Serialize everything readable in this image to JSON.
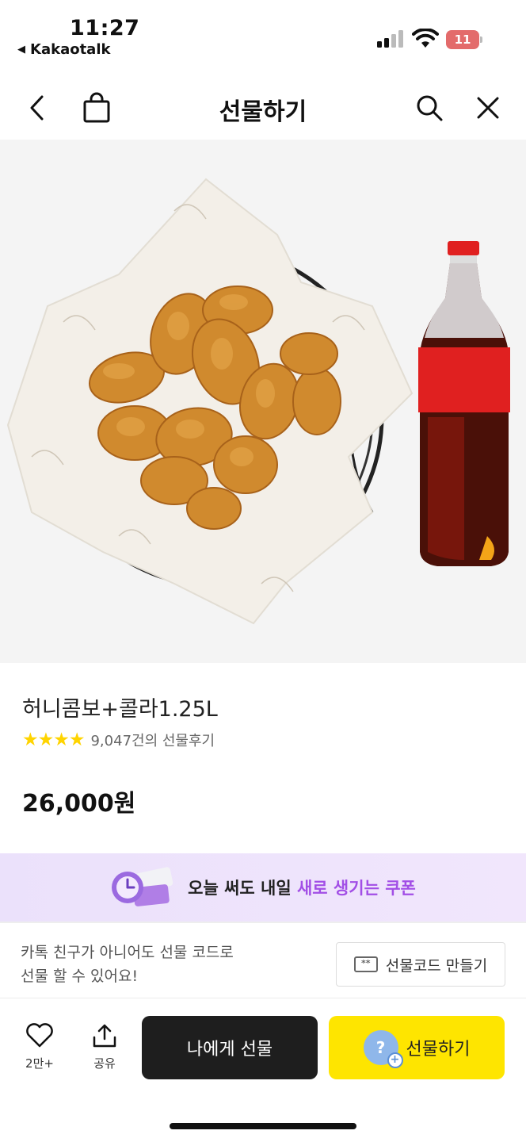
{
  "status_bar": {
    "time": "11:27",
    "back_app": "Kakaotalk",
    "battery": "11"
  },
  "header": {
    "title": "선물하기",
    "icons": [
      "back-arrow-icon",
      "shopping-bag-icon",
      "search-icon",
      "close-icon"
    ]
  },
  "product": {
    "name": "허니콤보+콜라1.25L",
    "stars": "★★★★",
    "rating_value": 4,
    "review_count": "9,047건의 선물후기",
    "price": "26,000원"
  },
  "coupon_banner": {
    "text_main": "오늘 써도 내일 ",
    "text_highlight": "새로 생기는 쿠폰",
    "accent": "#a24ee6"
  },
  "gift_code": {
    "desc_line1": "카톡 친구가 아니어도 선물 코드로",
    "desc_line2": "선물 할 수 있어요!",
    "icon_text": "**",
    "button_label": "선물코드 만들기"
  },
  "bottom_bar": {
    "wish_count": "2만+",
    "share_label": "공유",
    "gift_self_label": "나에게 선물",
    "gift_label": "선물하기",
    "gift_color": "#fee500"
  }
}
